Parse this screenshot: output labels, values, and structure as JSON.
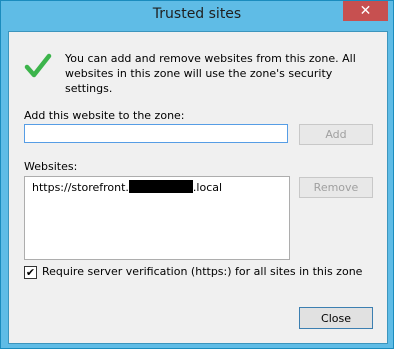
{
  "window": {
    "title": "Trusted sites",
    "close_glyph": "✕"
  },
  "dialog": {
    "intro_text": "You can add and remove websites from this zone. All websites in this zone will use the zone's security settings.",
    "add_label": "Add this website to the zone:",
    "add_input_value": "",
    "add_button": "Add",
    "websites_label": "Websites:",
    "websites": [
      {
        "prefix": "https://storefront.",
        "suffix": ".local"
      }
    ],
    "remove_button": "Remove",
    "require_https_label": "Require server verification (https:) for all sites in this zone",
    "require_https_checked": "✔",
    "close_button": "Close"
  },
  "colors": {
    "title_bar": "#5fbce6",
    "close_button_bg": "#c75050",
    "check_green": "#3cb44b"
  },
  "icons": {
    "status": "green-checkmark-icon"
  }
}
